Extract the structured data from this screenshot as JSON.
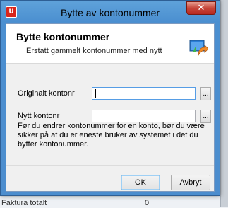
{
  "window": {
    "title": "Bytte av kontonummer",
    "app_icon": "app-logo-icon",
    "close_glyph": "✕"
  },
  "header": {
    "title": "Bytte kontonummer",
    "subtitle": "Erstatt gammelt kontonummer med nytt",
    "icon": "swap-document-icon"
  },
  "form": {
    "original_label": "Originalt kontonr",
    "original_value": "",
    "new_label": "Nytt kontonr",
    "new_value": "",
    "browse_label": "...",
    "warning": "Før du endrer kontonummer for en konto, bør du være sikker på at du er eneste bruker av systemet i det du bytter kontonummer."
  },
  "buttons": {
    "ok_label": "OK",
    "cancel_label": "Avbryt"
  },
  "background": {
    "row_label": "Faktura totalt",
    "row_value": "0"
  },
  "colors": {
    "titlebar": "#4b8fd0",
    "close_button": "#c6463a",
    "dialog_bg": "#f0f0f0"
  }
}
